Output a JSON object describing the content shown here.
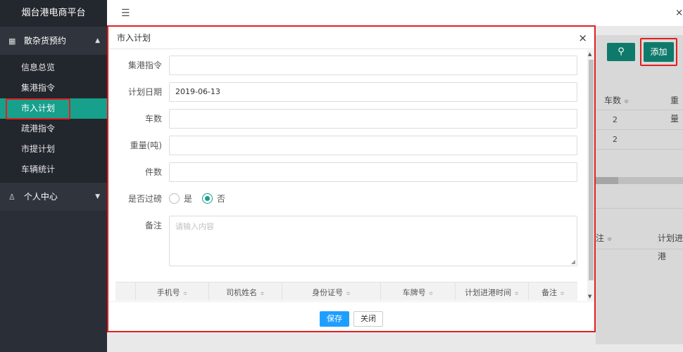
{
  "sidebar": {
    "brand": "烟台港电商平台",
    "group1": {
      "icon": "grid-icon",
      "label": "散杂货预约",
      "caret": "▲"
    },
    "items": [
      {
        "label": "信息总览"
      },
      {
        "label": "集港指令"
      },
      {
        "label": "市入计划"
      },
      {
        "label": "疏港指令"
      },
      {
        "label": "市提计划"
      },
      {
        "label": "车辆统计"
      }
    ],
    "group2": {
      "icon": "user-icon",
      "label": "个人中心",
      "caret": "▼"
    }
  },
  "topbar": {
    "toggle": "☰",
    "close": "×"
  },
  "background": {
    "search_icon": "⚲",
    "add_label": "添加",
    "col_cars": "车数",
    "col_weight": "重量",
    "col_tail": "注",
    "col_plan": "计划进港",
    "row_values": [
      "2",
      "2"
    ],
    "sort": "≑"
  },
  "modal": {
    "title": "市入计划",
    "close": "×",
    "fields": {
      "gather_order": {
        "label": "集港指令",
        "value": ""
      },
      "plan_date": {
        "label": "计划日期",
        "value": "2019-06-13"
      },
      "car_count": {
        "label": "车数",
        "value": ""
      },
      "weight": {
        "label": "重量(吨)",
        "value": ""
      },
      "pieces": {
        "label": "件数",
        "value": ""
      },
      "weigh": {
        "label": "是否过磅",
        "yes": "是",
        "no": "否",
        "selected": "否"
      },
      "remark": {
        "label": "备注",
        "placeholder": "请输入内容"
      }
    },
    "table_headers": [
      "手机号",
      "司机姓名",
      "身份证号",
      "车牌号",
      "计划进港时间",
      "备注"
    ],
    "sort_icon": "≑",
    "save_label": "保存",
    "close_label": "关闭"
  }
}
